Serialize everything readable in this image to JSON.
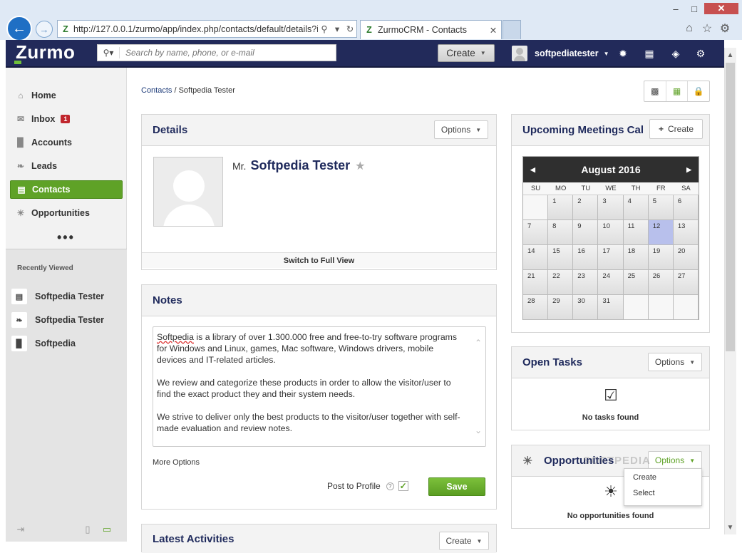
{
  "browser": {
    "url": "http://127.0.0.1/zurmo/app/index.php/contacts/default/details?i",
    "tab_title": "ZurmoCRM - Contacts"
  },
  "header": {
    "logo": "Zurmo",
    "search_placeholder": "Search by name, phone, or e-mail",
    "create_label": "Create",
    "username": "softpediatester"
  },
  "sidebar": {
    "items": [
      {
        "label": "Home",
        "icon": "home-icon"
      },
      {
        "label": "Inbox",
        "icon": "mail-icon",
        "badge": "1"
      },
      {
        "label": "Accounts",
        "icon": "folder-icon"
      },
      {
        "label": "Leads",
        "icon": "leaf-icon"
      },
      {
        "label": "Contacts",
        "icon": "contact-card-icon"
      },
      {
        "label": "Opportunities",
        "icon": "lightbulb-icon"
      }
    ],
    "more": "•••",
    "recently_viewed_title": "Recently Viewed",
    "recent": [
      {
        "label": "Softpedia Tester",
        "icon": "contact-card-icon"
      },
      {
        "label": "Softpedia Tester",
        "icon": "leaf-icon"
      },
      {
        "label": "Softpedia",
        "icon": "folder-icon"
      }
    ]
  },
  "breadcrumb": {
    "link": "Contacts",
    "separator": " / ",
    "current": "Softpedia Tester"
  },
  "details": {
    "title": "Details",
    "options": "Options",
    "salutation": "Mr.",
    "name": "Softpedia Tester",
    "switch_view": "Switch to Full View"
  },
  "notes": {
    "title": "Notes",
    "paragraphs": [
      "is a library of over 1.300.000 free and free-to-try software programs for Windows and Linux, games, Mac software, Windows drivers, mobile devices and IT-related articles.",
      "We review and categorize these products in order to allow the visitor/user to find the exact product they and their system needs.",
      "We strive to deliver only the best products to the visitor/user together with self-made evaluation and review notes."
    ],
    "first_word": "Softpedia",
    "more_options": "More Options",
    "post_to_profile": "Post to Profile",
    "help": "?",
    "save": "Save"
  },
  "latest_activities": {
    "title": "Latest Activities",
    "create": "Create"
  },
  "meetings": {
    "title": "Upcoming Meetings Cal",
    "create": "Create",
    "month": "August 2016",
    "days_of_week": [
      "SU",
      "MO",
      "TU",
      "WE",
      "TH",
      "FR",
      "SA"
    ],
    "cells": [
      "",
      "1",
      "2",
      "3",
      "4",
      "5",
      "6",
      "7",
      "8",
      "9",
      "10",
      "11",
      "12",
      "13",
      "14",
      "15",
      "16",
      "17",
      "18",
      "19",
      "20",
      "21",
      "22",
      "23",
      "24",
      "25",
      "26",
      "27",
      "28",
      "29",
      "30",
      "31",
      "",
      "",
      ""
    ],
    "highlighted_day": "12"
  },
  "open_tasks": {
    "title": "Open Tasks",
    "options": "Options",
    "empty": "No tasks found"
  },
  "opportunities": {
    "title": "Opportunities",
    "options": "Options",
    "empty": "No opportunities found",
    "dropdown": [
      "Create",
      "Select"
    ]
  },
  "watermark": "SOFTPEDIA",
  "colors": {
    "brand_header": "#222a5a",
    "active_green": "#5fa227",
    "title_navy": "#1f2a5c"
  }
}
